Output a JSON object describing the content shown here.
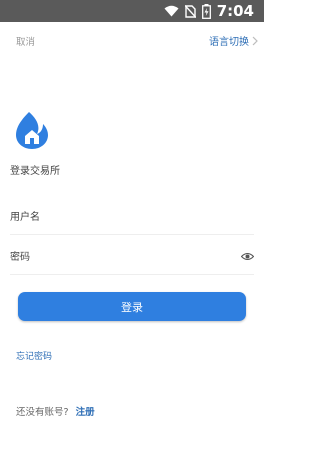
{
  "status_bar": {
    "time": "7:04",
    "icons": [
      "wifi-icon",
      "no-sim-icon",
      "battery-charging-icon"
    ]
  },
  "top_bar": {
    "cancel_label": "取消",
    "language_label": "语言切换",
    "language_icon": "chevron-right-icon"
  },
  "brand": {
    "subtitle": "登录交易所",
    "logo_icon": "flame-house-logo"
  },
  "form": {
    "username_placeholder": "用户名",
    "password_placeholder": "密码",
    "password_toggle_icon": "eye-icon",
    "login_label": "登录",
    "forgot_label": "忘记密码"
  },
  "footer": {
    "question": "还没有账号?",
    "register_label": "注册"
  },
  "colors": {
    "accent": "#2f7fe0",
    "link": "#2f6fb6",
    "status_bar": "#5a5a5a"
  }
}
